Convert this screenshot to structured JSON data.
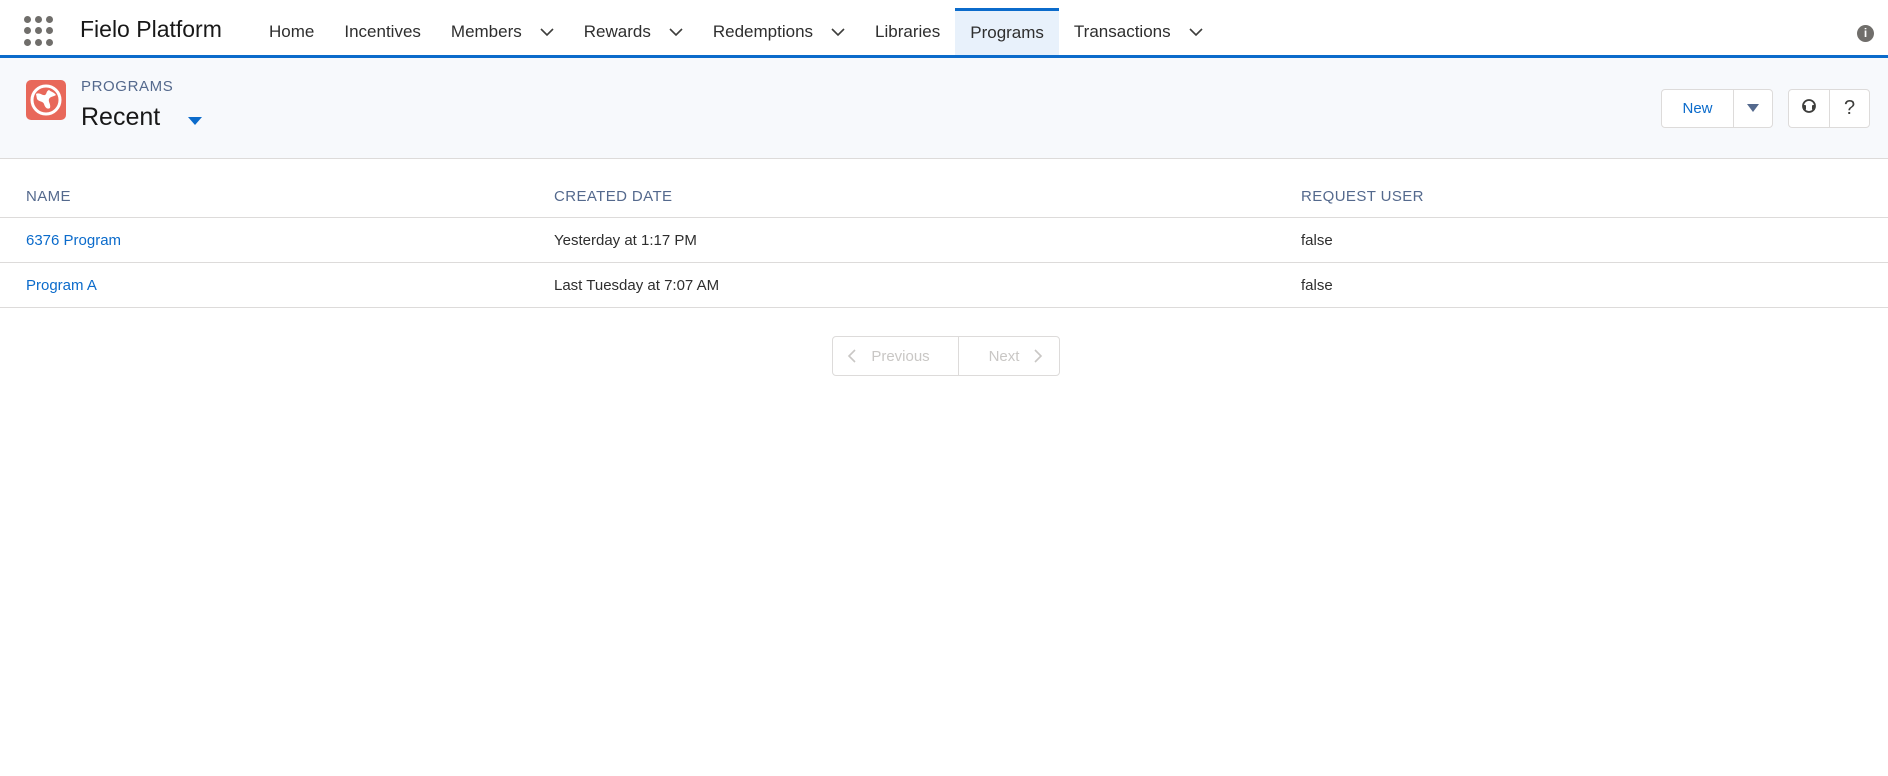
{
  "app": {
    "name": "Fielo Platform"
  },
  "nav": {
    "items": [
      {
        "label": "Home",
        "has_menu": false,
        "active": false
      },
      {
        "label": "Incentives",
        "has_menu": false,
        "active": false
      },
      {
        "label": "Members",
        "has_menu": true,
        "active": false
      },
      {
        "label": "Rewards",
        "has_menu": true,
        "active": false
      },
      {
        "label": "Redemptions",
        "has_menu": true,
        "active": false
      },
      {
        "label": "Libraries",
        "has_menu": false,
        "active": false
      },
      {
        "label": "Programs",
        "has_menu": false,
        "active": true
      },
      {
        "label": "Transactions",
        "has_menu": true,
        "active": false
      }
    ]
  },
  "header": {
    "object_label": "PROGRAMS",
    "list_view": "Recent",
    "new_label": "New",
    "help_label": "?"
  },
  "table": {
    "columns": [
      "NAME",
      "CREATED DATE",
      "REQUEST USER"
    ],
    "rows": [
      [
        "6376 Program",
        "Yesterday at 1:17 PM",
        "false"
      ],
      [
        "Program A",
        "Last Tuesday at 7:07 AM",
        "false"
      ]
    ]
  },
  "pagination": {
    "previous_label": "Previous",
    "next_label": "Next"
  },
  "colors": {
    "accent": "#0b6bcb",
    "object_icon": "#e8685a",
    "header_bg": "#f7f9fc"
  },
  "icons": [
    "app-launcher-icon",
    "chevron-down-icon",
    "info-icon",
    "globe-icon",
    "caret-down-icon",
    "chat-icon",
    "chevron-left-icon",
    "chevron-right-icon"
  ]
}
